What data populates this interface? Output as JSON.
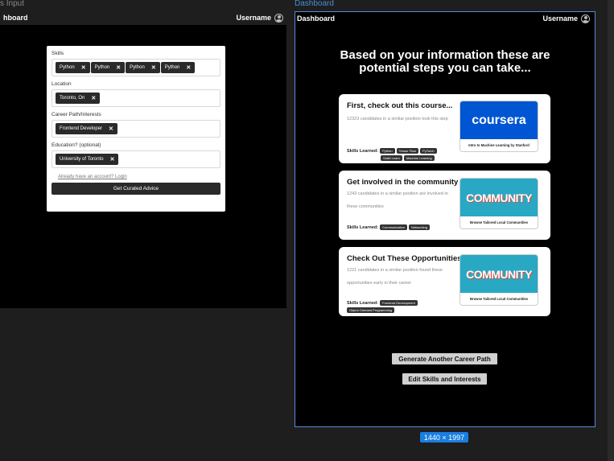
{
  "canvas": {
    "left_frame_label": "s Input",
    "right_frame_label": "Dashboard",
    "size_badge": "1440 × 1997"
  },
  "left_screen": {
    "topbar": {
      "title": "hboard",
      "username": "Username"
    },
    "form": {
      "skills_label": "Skills",
      "skills": [
        "Python",
        "Python",
        "Python",
        "Python"
      ],
      "location_label": "Location",
      "location": "Toronto, On",
      "career_label": "Career Path/Interests",
      "career": "Frontend Developer",
      "education_label": "Education? (optional)",
      "education": "University of Toronto",
      "login_link": "Already have an account? Login",
      "submit": "Get Curated Advice"
    }
  },
  "right_screen": {
    "topbar": {
      "title": "Dashboard",
      "username": "Username"
    },
    "headline_line1": "Based on your information these are",
    "headline_line2": "potential steps you can take...",
    "cards": [
      {
        "title": "First, check out this course...",
        "desc": "12323 candidates in a similar position took this step",
        "skills_label": "Skills Learned:",
        "skills": [
          "Python",
          "Tensor Flow",
          "PyTorch",
          "Scikit Learn",
          "Machine Learning"
        ],
        "promo_brand": "coursera",
        "promo_caption": "Intro to Machine Learning by Stanford"
      },
      {
        "title": "Get involved in the community",
        "desc": "1243 candidates in a similar position are involved in these communities",
        "skills_label": "Skills Learned:",
        "skills": [
          "Communication",
          "Networking"
        ],
        "promo_brand": "COMMUNITY",
        "promo_caption": "Browse Tailored Local Communities"
      },
      {
        "title": "Check Out These Opportunities",
        "desc": "1221 candidates in a similar position found these opportunities early in their career",
        "skills_label": "Skills Learned:",
        "skills": [
          "Frontend Development",
          "Object Oriented Programming"
        ],
        "promo_brand": "COMMUNITY",
        "promo_caption": "Browse Tailored Local Communities"
      }
    ],
    "generate_button": "Generate Another Career Path",
    "edit_button": "Edit Skills and Interests"
  }
}
